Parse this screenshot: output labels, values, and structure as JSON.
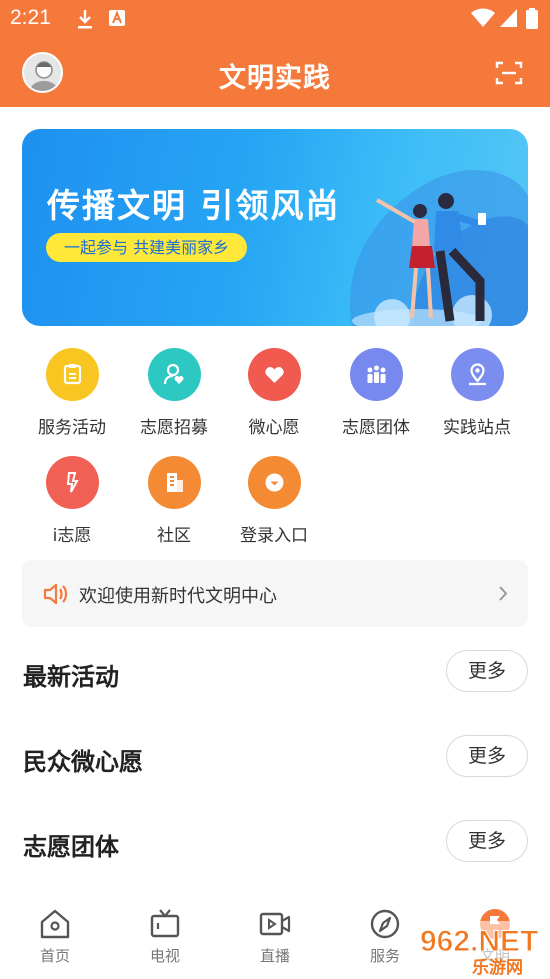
{
  "status_bar": {
    "time": "2:21"
  },
  "header": {
    "title": "文明实践"
  },
  "banner": {
    "title": "传播文明 引领风尚",
    "subtitle": "一起参与 共建美丽家乡"
  },
  "menu": [
    {
      "label": "服务活动",
      "color": "#f9c520",
      "icon": "clipboard-icon"
    },
    {
      "label": "志愿招募",
      "color": "#2ec8c2",
      "icon": "volunteer-recruit-icon"
    },
    {
      "label": "微心愿",
      "color": "#f05a4f",
      "icon": "heart-icon"
    },
    {
      "label": "志愿团体",
      "color": "#7788ee",
      "icon": "group-icon"
    },
    {
      "label": "实践站点",
      "color": "#7b8ef0",
      "icon": "location-pin-icon"
    },
    {
      "label": "i志愿",
      "color": "#f06055",
      "icon": "i-volunteer-icon"
    },
    {
      "label": "社区",
      "color": "#f58a35",
      "icon": "building-icon"
    },
    {
      "label": "登录入口",
      "color": "#f58a35",
      "icon": "login-icon"
    }
  ],
  "notice": {
    "text": "欢迎使用新时代文明中心"
  },
  "sections": [
    {
      "title": "最新活动",
      "more": "更多"
    },
    {
      "title": "民众微心愿",
      "more": "更多"
    },
    {
      "title": "志愿团体",
      "more": "更多"
    }
  ],
  "tabs": [
    {
      "label": "首页",
      "icon": "home-icon"
    },
    {
      "label": "电视",
      "icon": "tv-icon"
    },
    {
      "label": "直播",
      "icon": "live-video-icon"
    },
    {
      "label": "服务",
      "icon": "compass-icon"
    },
    {
      "label": "文明",
      "icon": "flag-icon"
    }
  ],
  "watermark": {
    "text": "962.NET",
    "subtext": "乐游网"
  },
  "colors": {
    "accent": "#f5793b",
    "banner_pill": "#ffe83a"
  }
}
